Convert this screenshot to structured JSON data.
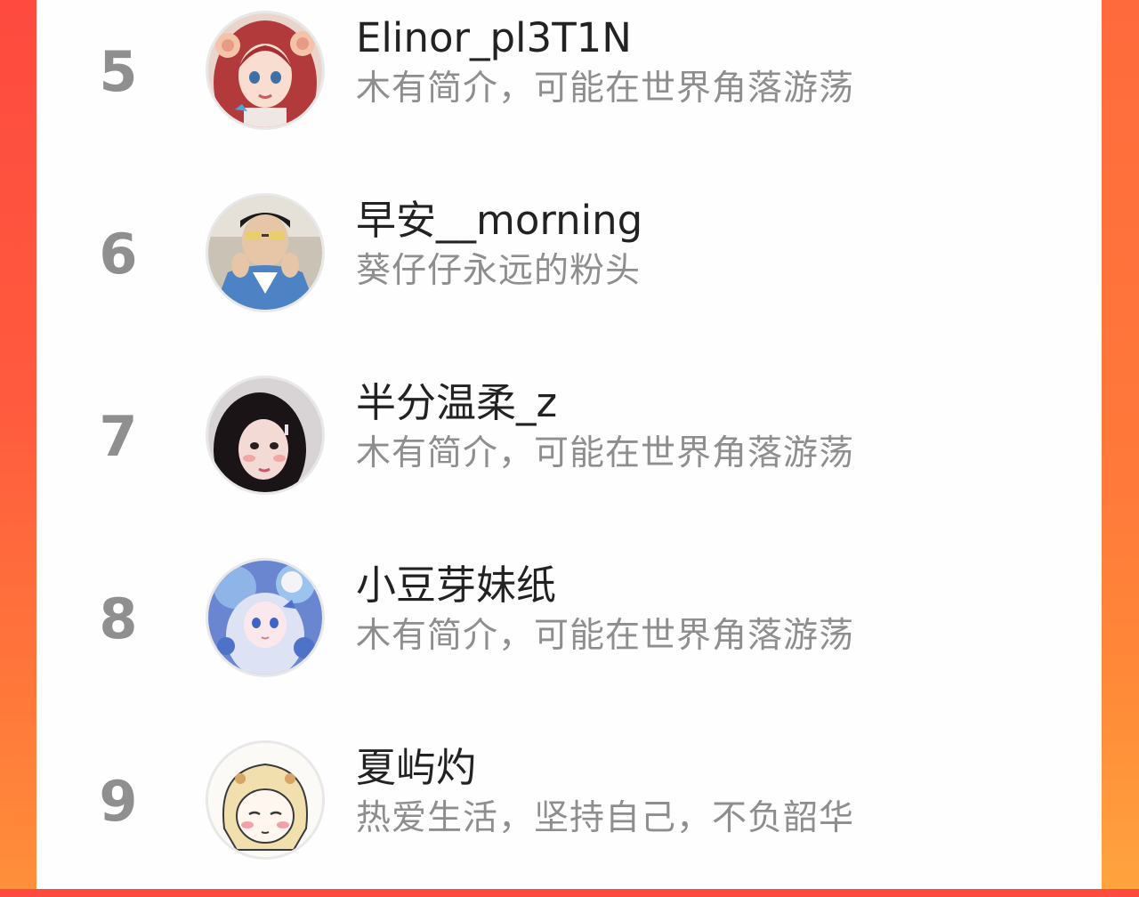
{
  "ranking": {
    "entries": [
      {
        "rank": "5",
        "username": "Elinor_pl3T1N",
        "bio": "木有简介，可能在世界角落游荡",
        "avatar": "red-haired-anime-girl-avatar"
      },
      {
        "rank": "6",
        "username": "早安__morning",
        "bio": "葵仔仔永远的粉头",
        "avatar": "man-with-sunglasses-photo-avatar"
      },
      {
        "rank": "7",
        "username": "半分温柔_z",
        "bio": "木有简介，可能在世界角落游荡",
        "avatar": "girl-with-bangs-photo-avatar"
      },
      {
        "rank": "8",
        "username": "小豆芽妹纸",
        "bio": "木有简介，可能在世界角落游荡",
        "avatar": "blue-fantasy-anime-girl-avatar"
      },
      {
        "rank": "9",
        "username": "夏屿灼",
        "bio": "热爱生活，坚持自己，不负韶华",
        "avatar": "blonde-chibi-girl-avatar"
      }
    ]
  },
  "colors": {
    "background_gradient_start": "#fe4a3f",
    "background_gradient_end": "#ff8f3a",
    "panel": "#fefefe",
    "rank_text": "#8f8f8f",
    "username_text": "#222222",
    "bio_text": "#8e8e8e"
  }
}
